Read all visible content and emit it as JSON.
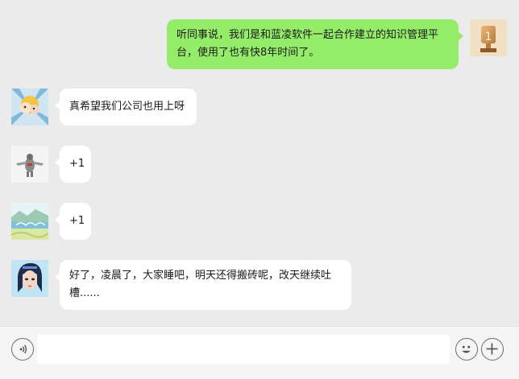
{
  "messages": [
    {
      "side": "right",
      "avatar": "trophy-avatar",
      "text": "听同事说，我们是和蓝凌软件一起合作建立的知识管理平台，使用了也有快8年时间了。"
    },
    {
      "side": "left",
      "avatar": "cartoon-avatar",
      "text": "真希望我们公司也用上呀"
    },
    {
      "side": "left",
      "avatar": "figure-avatar",
      "text": "+1"
    },
    {
      "side": "left",
      "avatar": "landscape-avatar",
      "text": "+1"
    },
    {
      "side": "left",
      "avatar": "anime-avatar",
      "text": "好了，凌晨了，大家睡吧，明天还得搬砖呢，改天继续吐槽......"
    }
  ],
  "input": {
    "value": "",
    "placeholder": ""
  },
  "icons": {
    "voice": "voice-icon",
    "emoji": "emoji-icon",
    "more": "plus-icon"
  },
  "colors": {
    "background": "#ebebeb",
    "self_bubble": "#95ec69",
    "other_bubble": "#ffffff",
    "input_bar": "#f5f5f5"
  }
}
